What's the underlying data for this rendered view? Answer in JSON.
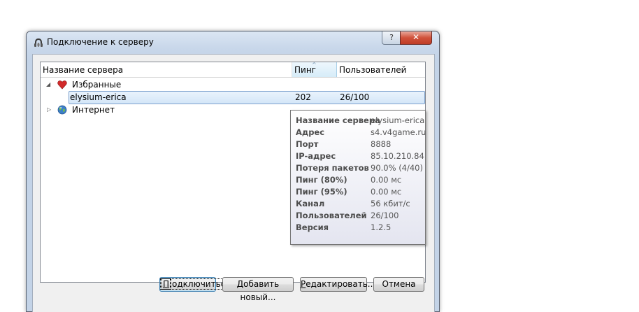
{
  "window": {
    "title": "Подключение к серверу",
    "help_label": "?",
    "close_label": "✕"
  },
  "tree": {
    "columns": {
      "name": "Название сервера",
      "ping": "Пинг",
      "users": "Пользователей"
    },
    "groups": [
      {
        "label": "Избранные",
        "expanded": true,
        "icon": "heart-icon",
        "items": [
          {
            "name": "elysium-erica",
            "ping": "202",
            "users": "26/100"
          }
        ]
      },
      {
        "label": "Интернет",
        "expanded": false,
        "icon": "globe-icon",
        "items": []
      }
    ]
  },
  "tooltip": {
    "rows": [
      {
        "key": "Название сервера",
        "value": "elysium-erica"
      },
      {
        "key": "Адрес",
        "value": "s4.v4game.ru"
      },
      {
        "key": "Порт",
        "value": "8888"
      },
      {
        "key": "IP-адрес",
        "value": "85.10.210.84"
      },
      {
        "key": "Потеря пакетов",
        "value": "90.0% (4/40)"
      },
      {
        "key": "Пинг (80%)",
        "value": "0.00 мс"
      },
      {
        "key": "Пинг (95%)",
        "value": "0.00 мс"
      },
      {
        "key": "Канал",
        "value": "56 кбит/с"
      },
      {
        "key": "Пользователей",
        "value": "26/100"
      },
      {
        "key": "Версия",
        "value": "1.2.5"
      }
    ]
  },
  "buttons": {
    "connect": {
      "mnemonic": "П",
      "rest": "одключиться"
    },
    "add": {
      "mnemonic": "Д",
      "rest": "обавить новый..."
    },
    "edit": {
      "mnemonic": "Р",
      "rest": "едактировать..."
    },
    "cancel": "Отмена"
  },
  "colors": {
    "selection": "#d3e6f8",
    "selection_border": "#7da2ce",
    "close": "#c03d27"
  }
}
